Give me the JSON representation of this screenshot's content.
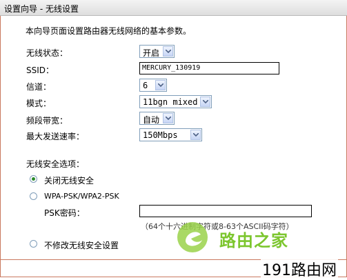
{
  "title": "设置向导 - 无线设置",
  "intro": "本向导页面设置路由器无线网络的基本参数。",
  "fields": {
    "wireless_status": {
      "label": "无线状态：",
      "value": "开启"
    },
    "ssid": {
      "label": "SSID：",
      "value": "MERCURY_130919"
    },
    "channel": {
      "label": "信道：",
      "value": "6"
    },
    "mode": {
      "label": "模式：",
      "value": "11bgn mixed"
    },
    "bandwidth": {
      "label": "频段带宽：",
      "value": "自动"
    },
    "max_rate": {
      "label": "最大发送速率：",
      "value": "150Mbps"
    }
  },
  "security": {
    "heading": "无线安全选项：",
    "options": [
      {
        "label": "关闭无线安全",
        "selected": true
      },
      {
        "label": "WPA-PSK/WPA2-PSK",
        "selected": false
      },
      {
        "label": "不修改无线安全设置",
        "selected": false
      }
    ],
    "psk_label": "PSK密码：",
    "psk_value": "",
    "psk_hint": "（64个十六进制字符或8-63个ASCII码字符）"
  },
  "watermark": {
    "brand": "路由之家",
    "site": "191路由网"
  },
  "colors": {
    "frame_border": "#c9785e",
    "radio_selected": "#2b8a2b",
    "brand_green": "#7cc62e"
  }
}
